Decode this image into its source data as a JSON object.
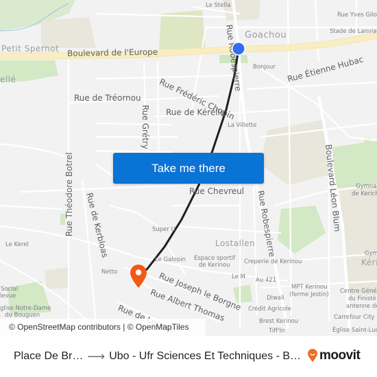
{
  "map": {
    "streets": [
      {
        "id": "bd-europe",
        "label": "Boulevard de l'Europe"
      },
      {
        "id": "rue-robespierre-n",
        "label": "Rue Robespierre"
      },
      {
        "id": "rue-frederic-chopin",
        "label": "Rue Frédéric Chopin"
      },
      {
        "id": "rue-treornou",
        "label": "Rue de Tréornou"
      },
      {
        "id": "rue-kerelie",
        "label": "Rue de Kérélie"
      },
      {
        "id": "rue-gretry",
        "label": "Rue Grétry"
      },
      {
        "id": "rue-etienne-hubac",
        "label": "Rue Étienne Hubac"
      },
      {
        "id": "bd-leon-blum",
        "label": "Boulevard Léon Blum"
      },
      {
        "id": "rue-theodore-botrel",
        "label": "Rue Théodore Botrel"
      },
      {
        "id": "rue-kerbloas",
        "label": "Rue de Kerbloas"
      },
      {
        "id": "rue-chevreul",
        "label": "Rue Chevreul"
      },
      {
        "id": "rue-robespierre-s",
        "label": "Rue Robespierre"
      },
      {
        "id": "rue-joseph-le-borgne",
        "label": "Rue Joseph le Borgne"
      },
      {
        "id": "rue-albert-thomas",
        "label": "Rue Albert Thomas"
      },
      {
        "id": "rue-de-lorient",
        "label": "Rue de Lorient"
      }
    ],
    "areas": [
      {
        "id": "goachou",
        "label": "Goachou"
      },
      {
        "id": "petit-spernot",
        "label": "Petit Spernot"
      },
      {
        "id": "elle",
        "label": "ellé"
      },
      {
        "id": "lostallen",
        "label": "Lostallen"
      },
      {
        "id": "kerinou",
        "label": "Kéri"
      }
    ],
    "pois": [
      {
        "id": "le-stella",
        "label": "Le Stella"
      },
      {
        "id": "rue-yves-giloux",
        "label": "Rue Yves Gilou"
      },
      {
        "id": "stade-lanvian",
        "label": "Stade de Lanvian"
      },
      {
        "id": "bonjour",
        "label": "Bonjour"
      },
      {
        "id": "la-villette",
        "label": "La Villette"
      },
      {
        "id": "gymnase",
        "label": "Gymnas"
      },
      {
        "id": "gymnase-kerich",
        "label": "de Kerich"
      },
      {
        "id": "gym2",
        "label": "Gym"
      },
      {
        "id": "super-u",
        "label": "Super U"
      },
      {
        "id": "le-kerel",
        "label": "Le Kerel"
      },
      {
        "id": "le-galopin",
        "label": "Le Galopin"
      },
      {
        "id": "espace-sportif",
        "label": "Espace sportif"
      },
      {
        "id": "espace-sportif-2",
        "label": "de Kerinou"
      },
      {
        "id": "creperie",
        "label": "Creperie de Kerinou"
      },
      {
        "id": "netto",
        "label": "Netto"
      },
      {
        "id": "le-m",
        "label": "Le M"
      },
      {
        "id": "au-421",
        "label": "Au 421"
      },
      {
        "id": "mpt-kerinou",
        "label": "MPT Kerinou"
      },
      {
        "id": "mpt-kerinou-2",
        "label": "(ferme Jestin)"
      },
      {
        "id": "diwali",
        "label": "Diwali"
      },
      {
        "id": "credit-agricole",
        "label": "Crédit Agricole"
      },
      {
        "id": "brest-kerinou",
        "label": "Brest Kerinou"
      },
      {
        "id": "tiffin",
        "label": "Tiff'In"
      },
      {
        "id": "centre-genea",
        "label": "Centre Généa"
      },
      {
        "id": "centre-genea-2",
        "label": "du Finistè"
      },
      {
        "id": "centre-genea-3",
        "label": "antenne de"
      },
      {
        "id": "carrefour-city",
        "label": "Carrefour City"
      },
      {
        "id": "eglise-saint-luc",
        "label": "Église Saint-Luc"
      },
      {
        "id": "social",
        "label": "Social"
      },
      {
        "id": "bellevue",
        "label": "levue"
      },
      {
        "id": "eglise-notre-dame",
        "label": "glise Notre-Dame"
      },
      {
        "id": "eglise-notre-dame-2",
        "label": "du Bouguen"
      }
    ],
    "origin_marker": {
      "label": "origin",
      "color": "#2f6ef5"
    },
    "destination_marker": {
      "label": "destination",
      "color": "#f05a14"
    },
    "route_color": "#1f1f1f",
    "attribution": "© OpenStreetMap contributors | © OpenMapTiles"
  },
  "cta": {
    "label": "Take me there",
    "color": "#0a73d6"
  },
  "footer": {
    "origin": "Place De Br…",
    "destination": "Ubo - Ufr Sciences Et Techniques - B…",
    "brand": "moovit",
    "brand_color": "#f26b21"
  }
}
